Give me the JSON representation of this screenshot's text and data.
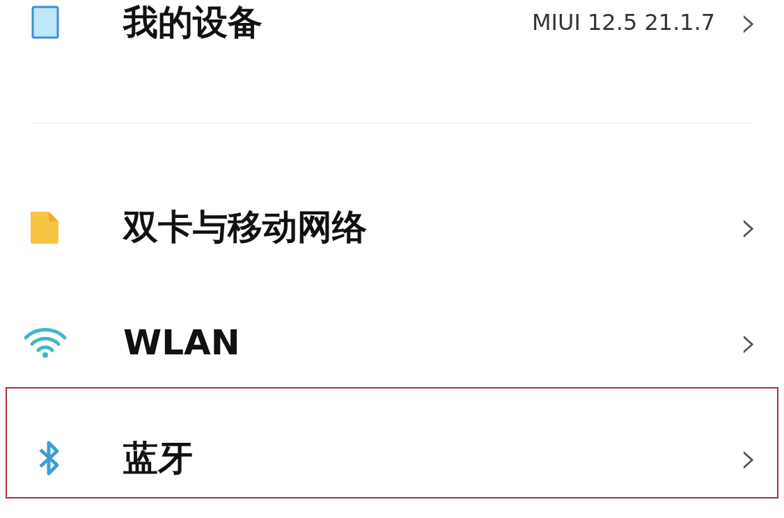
{
  "device_row": {
    "label": "我的设备",
    "value": "MIUI 12.5 21.1.7",
    "chevron": "›"
  },
  "items": [
    {
      "kind": "sim",
      "label": "双卡与移动网络",
      "chevron": "›",
      "highlighted": false
    },
    {
      "kind": "wifi",
      "label": "WLAN",
      "chevron": "›",
      "highlighted": false
    },
    {
      "kind": "bluetooth",
      "label": "蓝牙",
      "chevron": "›",
      "highlighted": true
    }
  ]
}
